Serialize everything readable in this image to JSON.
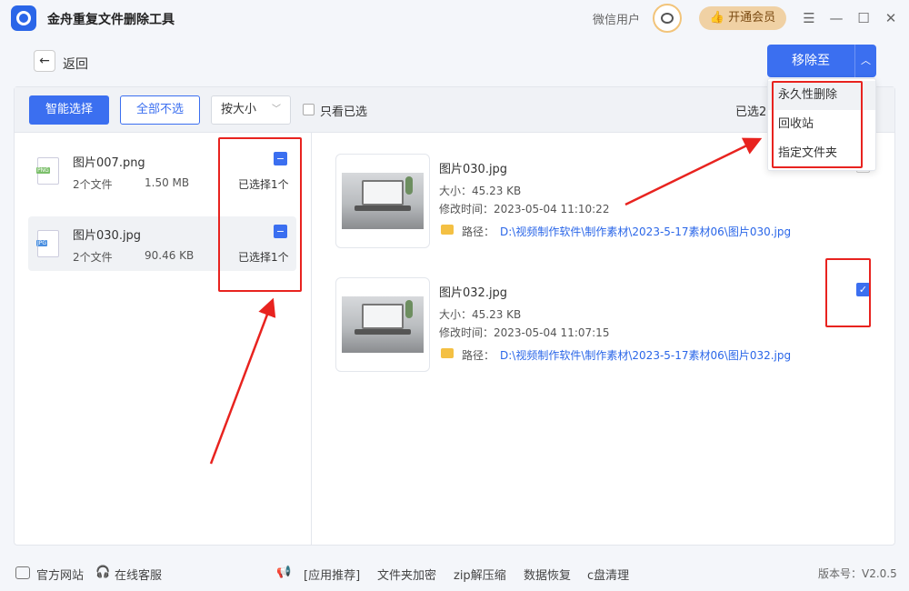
{
  "app": {
    "title": "金舟重复文件删除工具"
  },
  "header": {
    "user_name": "微信用户",
    "vip_label": "开通会员"
  },
  "nav": {
    "back_label": "返回",
    "move_label": "移除至"
  },
  "toolbar": {
    "smart_select": "智能选择",
    "unselect_all": "全部不选",
    "sort_value": "按大小",
    "only_selected": "只看已选",
    "selected_count": "已选2"
  },
  "groups": [
    {
      "name": "图片007.png",
      "count": "2个文件",
      "size": "1.50 MB",
      "status": "已选择1个",
      "type": "PNG"
    },
    {
      "name": "图片030.jpg",
      "count": "2个文件",
      "size": "90.46 KB",
      "status": "已选择1个",
      "type": "JPG"
    }
  ],
  "files": [
    {
      "name": "图片030.jpg",
      "size": "大小：45.23 KB",
      "time": "修改时间：2023-05-04 11:10:22",
      "path_label": "路径：",
      "path": "D:\\视频制作软件\\制作素材\\2023-5-17素材06\\图片030.jpg",
      "checked": false
    },
    {
      "name": "图片032.jpg",
      "size": "大小：45.23 KB",
      "time": "修改时间：2023-05-04 11:07:15",
      "path_label": "路径：",
      "path": "D:\\视频制作软件\\制作素材\\2023-5-17素材06\\图片032.jpg",
      "checked": true
    }
  ],
  "dropdown": {
    "items": [
      "永久性删除",
      "回收站",
      "指定文件夹"
    ]
  },
  "footer": {
    "website": "官方网站",
    "support": "在线客服",
    "recommend": "[应用推荐]",
    "encrypt": "文件夹加密",
    "zip": "zip解压缩",
    "recovery": "数据恢复",
    "cdisk": "c盘清理",
    "version": "版本号：V2.0.5"
  },
  "colors": {
    "accent": "#3b6ff0",
    "annotation": "#e8231f",
    "vip": "#f0d1a4"
  }
}
